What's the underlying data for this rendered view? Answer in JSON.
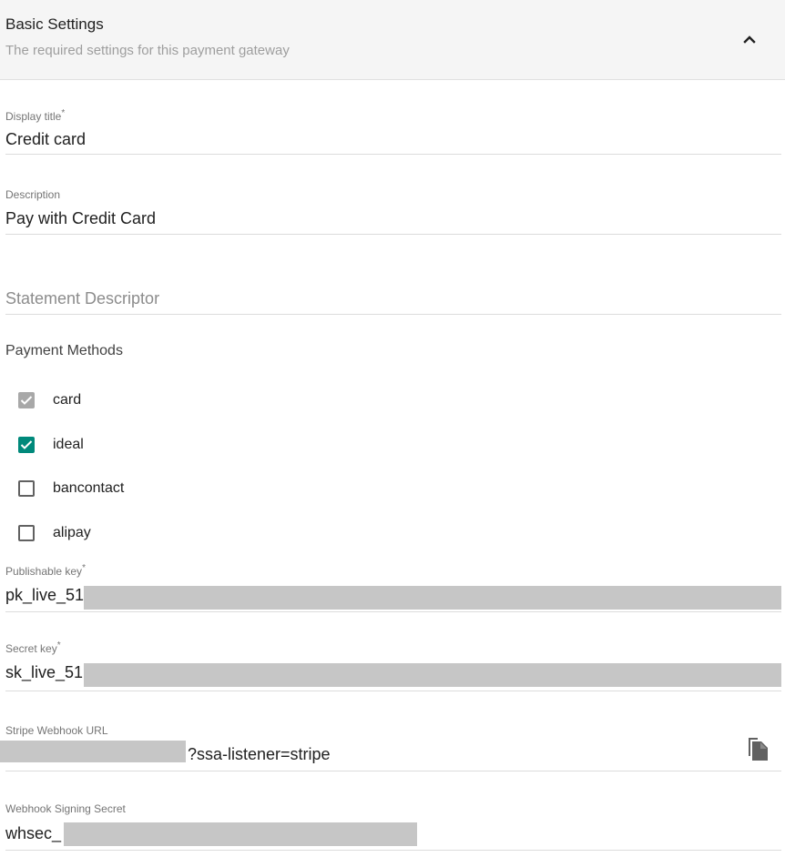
{
  "header": {
    "title": "Basic Settings",
    "subtitle": "The required settings for this payment gateway",
    "toggle_icon": "chevron-up-icon"
  },
  "fields": {
    "display_title": {
      "label": "Display title",
      "required": "*",
      "value": "Credit card"
    },
    "description": {
      "label": "Description",
      "value": "Pay with Credit Card"
    },
    "statement_descriptor": {
      "placeholder": "Statement Descriptor",
      "value": ""
    },
    "publishable_key": {
      "label": "Publishable key",
      "required": "*",
      "value": "pk_live_51"
    },
    "secret_key": {
      "label": "Secret key",
      "required": "*",
      "value": "sk_live_51"
    },
    "webhook_url": {
      "label": "Stripe Webhook URL",
      "value": "?ssa-listener=stripe",
      "copy_icon": "copy-icon"
    },
    "webhook_secret": {
      "label": "Webhook Signing Secret",
      "value": "whsec_"
    }
  },
  "payment_methods": {
    "label": "Payment Methods",
    "options": [
      {
        "label": "card",
        "checked": true,
        "disabled": true
      },
      {
        "label": "ideal",
        "checked": true,
        "disabled": false
      },
      {
        "label": "bancontact",
        "checked": false,
        "disabled": false
      },
      {
        "label": "alipay",
        "checked": false,
        "disabled": false
      }
    ]
  },
  "colors": {
    "header_bg": "#f5f5f5",
    "accent": "#00897b",
    "disabled_check": "#a8a8a8",
    "redaction": "#c6c6c6"
  }
}
